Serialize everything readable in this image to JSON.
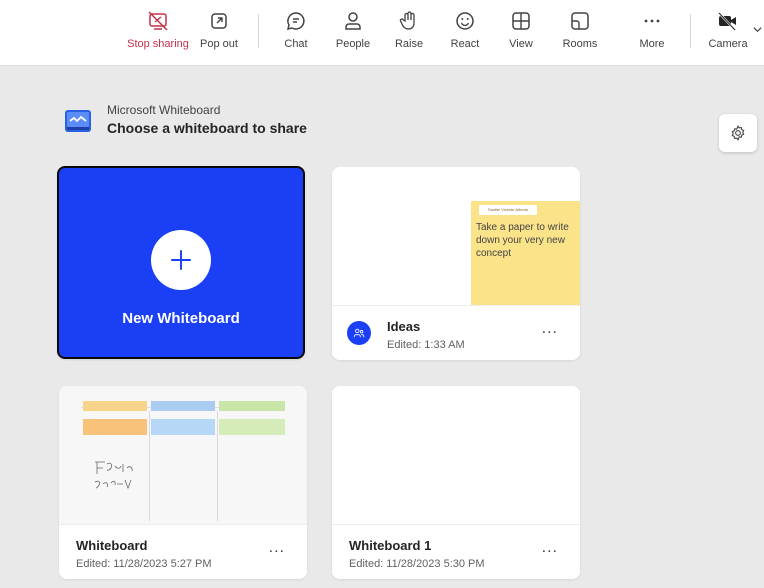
{
  "toolbar": {
    "items": [
      {
        "label": "Stop sharing",
        "icon": "stop-sharing-icon"
      },
      {
        "label": "Pop out",
        "icon": "pop-out-icon"
      },
      {
        "label": "Chat",
        "icon": "chat-icon"
      },
      {
        "label": "People",
        "icon": "people-icon"
      },
      {
        "label": "Raise",
        "icon": "raise-hand-icon"
      },
      {
        "label": "React",
        "icon": "react-icon"
      },
      {
        "label": "View",
        "icon": "view-icon"
      },
      {
        "label": "Rooms",
        "icon": "rooms-icon"
      },
      {
        "label": "More",
        "icon": "more-icon"
      },
      {
        "label": "Camera",
        "icon": "camera-off-icon"
      }
    ],
    "danger_color": "#c4314b"
  },
  "header": {
    "app_name": "Microsoft Whiteboard",
    "title": "Choose a whiteboard to share"
  },
  "cards": {
    "new": {
      "label": "New Whiteboard",
      "color": "#1b3ff5"
    },
    "ideas": {
      "name": "Ideas",
      "edited": "Edited: 1:33 AM",
      "sticky_author": "Santiel Vicente Alfredo",
      "sticky_text": "Take a paper to write down your very new concept"
    },
    "whiteboard": {
      "name": "Whiteboard",
      "edited": "Edited: 11/28/2023 5:27 PM"
    },
    "whiteboard1": {
      "name": "Whiteboard 1",
      "edited": "Edited: 11/28/2023 5:30 PM"
    },
    "more_label": "..."
  }
}
